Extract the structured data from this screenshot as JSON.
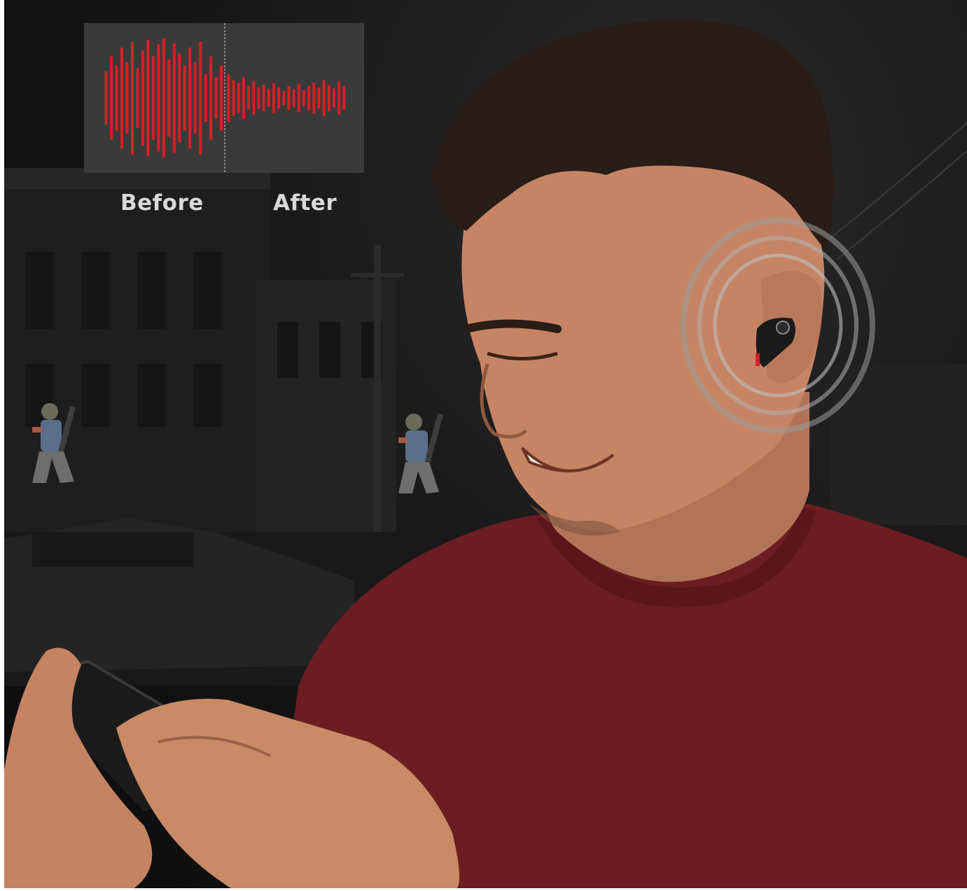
{
  "waveform": {
    "before_label": "Before",
    "after_label": "After",
    "wave_color": "#d61f26",
    "panel_color": "#3a3a3a",
    "before_amplitudes": [
      0.45,
      0.7,
      0.55,
      0.85,
      0.6,
      0.95,
      0.5,
      0.8,
      0.98,
      0.7,
      0.9,
      1.0,
      0.65,
      0.92,
      0.75,
      0.55,
      0.85,
      0.6,
      0.95,
      0.4,
      0.7,
      0.35,
      0.55
    ],
    "after_amplitudes": [
      0.4,
      0.3,
      0.25,
      0.35,
      0.2,
      0.28,
      0.18,
      0.22,
      0.15,
      0.25,
      0.18,
      0.12,
      0.2,
      0.15,
      0.24,
      0.14,
      0.2,
      0.26,
      0.18,
      0.3,
      0.22,
      0.16,
      0.28,
      0.2
    ]
  },
  "scene": {
    "subject": "person-playing-mobile-game",
    "shirt_color": "#6b1d22",
    "background_color": "#151515",
    "earbud_color": "#1a1a1a",
    "earbud_accent": "#d61f26"
  }
}
